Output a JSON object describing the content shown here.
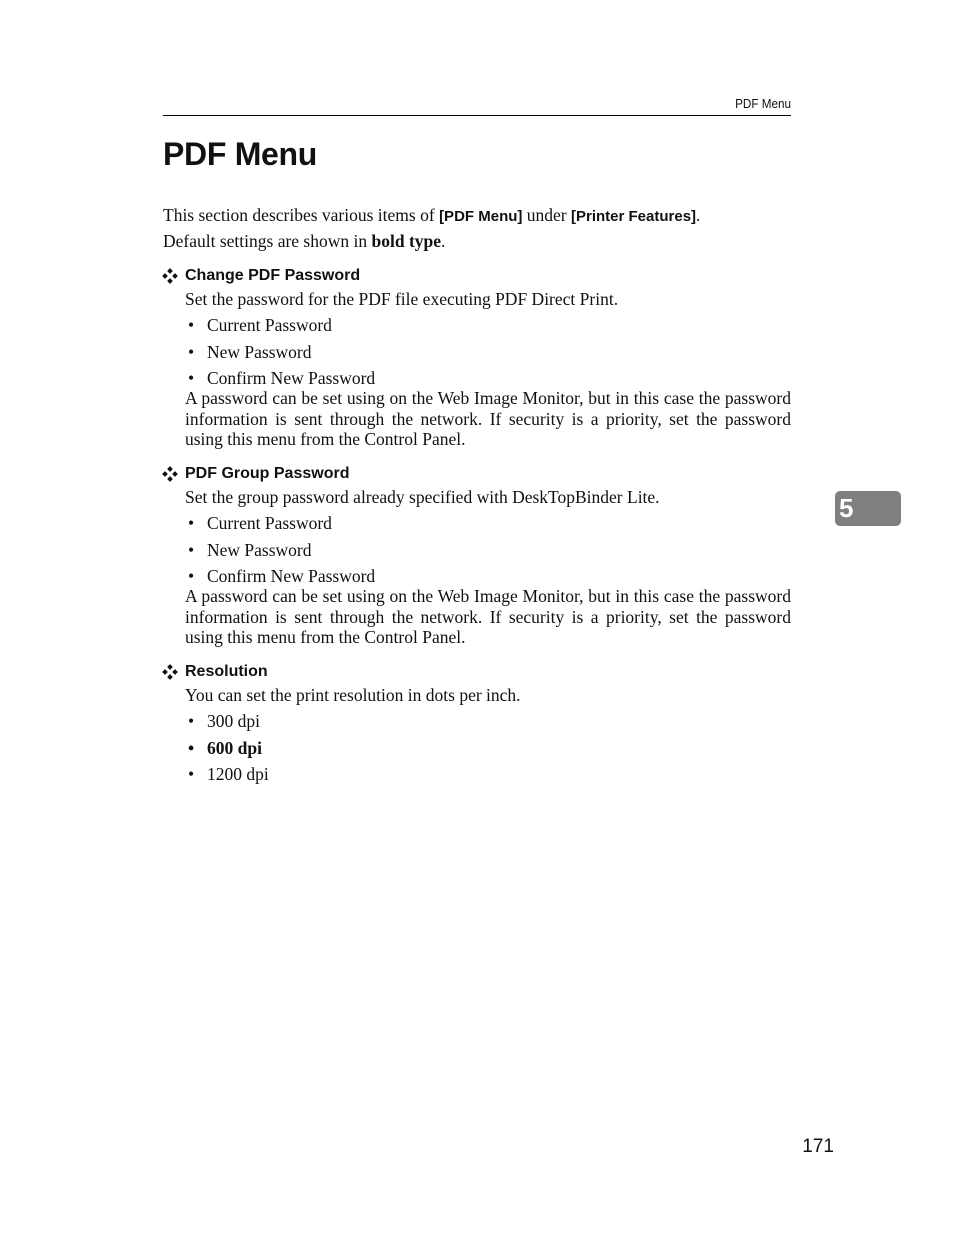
{
  "header": {
    "running_head": "PDF Menu"
  },
  "title": "PDF Menu",
  "intro": {
    "line1_pre": "This section describes various items of ",
    "line1_item": "[PDF Menu]",
    "line1_mid": " under ",
    "line1_parent": "[Printer Features]",
    "line1_end": ".",
    "line2_pre": "Default settings are shown in ",
    "line2_bold": "bold type",
    "line2_end": "."
  },
  "sections": [
    {
      "heading": "Change PDF Password",
      "description": "Set the password for the PDF file executing PDF Direct Print.",
      "options": [
        "Current Password",
        "New Password",
        "Confirm New Password"
      ],
      "note": "A password can be set using on the Web Image Monitor, but in this case the password information is sent through the network. If security is a priority, set the password using this menu from the Control Panel."
    },
    {
      "heading": "PDF Group Password",
      "description": "Set the group password already specified with DeskTopBinder Lite.",
      "options": [
        "Current Password",
        "New Password",
        "Confirm New Password"
      ],
      "note": "A password can be set using on the Web Image Monitor, but in this case the password information is sent through the network. If security is a priority, set the password using this menu from the Control Panel."
    },
    {
      "heading": "Resolution",
      "description": "You can set the print resolution in dots per inch.",
      "options": [
        "300 dpi",
        "600 dpi",
        "1200 dpi"
      ],
      "default_option": "600 dpi"
    }
  ],
  "chapter_tab": "5",
  "page_number": "171",
  "colors": {
    "chapter_tab_bg": "#808080",
    "text": "#111111"
  }
}
